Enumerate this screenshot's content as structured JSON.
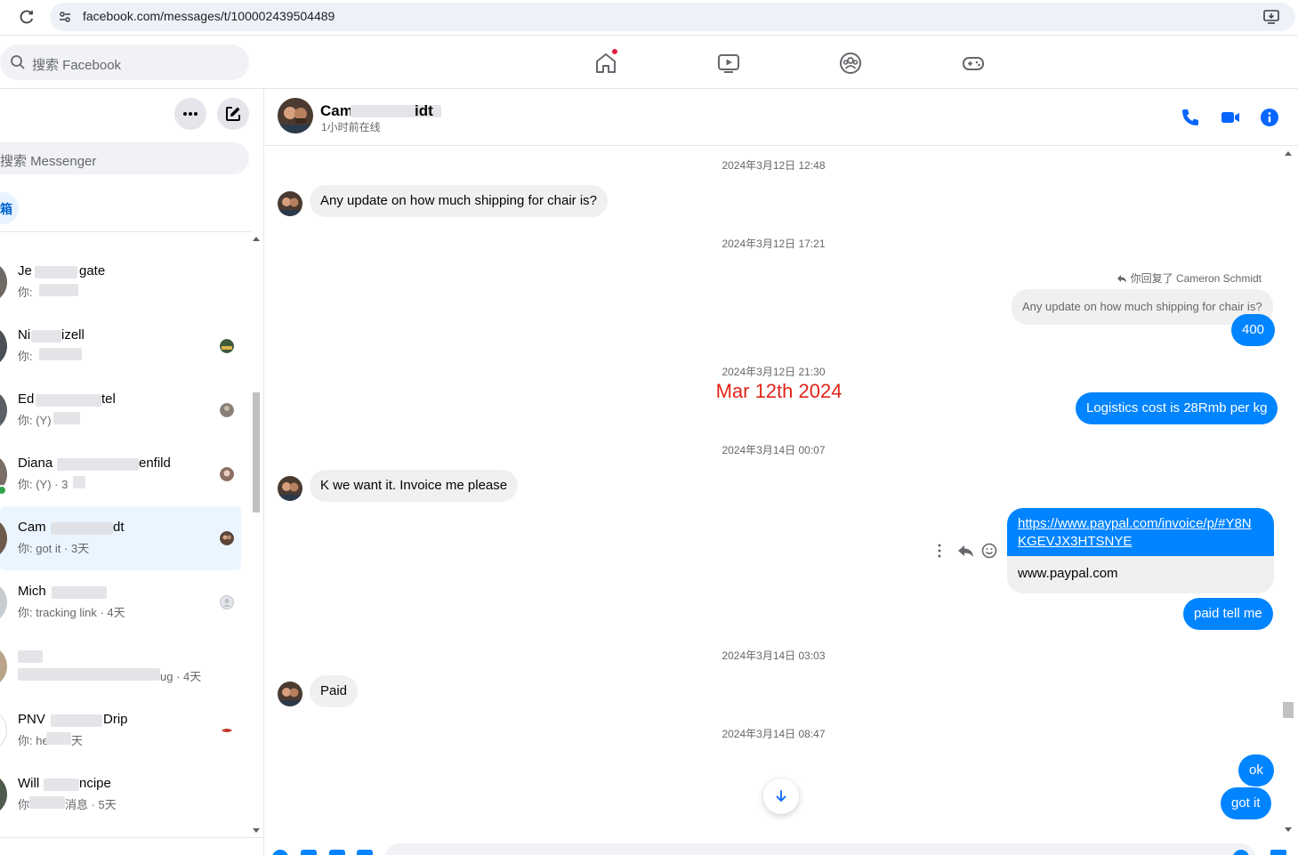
{
  "browser": {
    "url": "facebook.com/messages/t/100002439504489"
  },
  "fb_nav": {
    "search_placeholder": "搜索 Facebook"
  },
  "sidebar": {
    "search_placeholder": "搜索 Messenger",
    "inbox_label": "箱",
    "chats": [
      {
        "name": "Je",
        "name_end": "gate",
        "preview": "你:",
        "preview_end": ""
      },
      {
        "name": "Ni",
        "name_end": "izell",
        "preview": "你:",
        "preview_end": ""
      },
      {
        "name": "Ed",
        "name_end": "tel",
        "preview": "你: (Y)",
        "preview_end": ""
      },
      {
        "name": "Diana",
        "name_end": "enfild",
        "preview": "你: (Y) · 3",
        "preview_end": ""
      },
      {
        "name": "Cam",
        "name_end": "dt",
        "preview": "你: got it · 3天",
        "preview_end": ""
      },
      {
        "name": "Mich",
        "name_end": "",
        "preview": "你: tracking link · 4天",
        "preview_end": ""
      },
      {
        "name": "",
        "name_end": "",
        "preview": "",
        "preview_end": "ug · 4天"
      },
      {
        "name": "PNV",
        "name_end": "Drip",
        "preview": "你: he",
        "preview_end": "天"
      },
      {
        "name": "Will",
        "name_end": "ncipe",
        "preview": "你",
        "preview_end": "消息 · 5天"
      }
    ]
  },
  "chat": {
    "contact_name_start": "Cam",
    "contact_name_end": "idt",
    "status": "1小时前在线",
    "timestamps": [
      "2024年3月12日 12:48",
      "2024年3月12日 17:21",
      "2024年3月12日 21:30",
      "2024年3月14日 00:07",
      "2024年3月14日 03:03",
      "2024年3月14日 08:47"
    ],
    "annotation": "Mar 12th 2024",
    "reply_label": "你回复了 Cameron Schmidt",
    "quoted_text": "Any update on how much shipping for chair is?",
    "messages": {
      "m1": "Any update on how much shipping for chair is?",
      "m2": "400",
      "m3": "Logistics cost is 28Rmb per kg",
      "m4": "K we want it. Invoice me please",
      "link_url_line1": "https://www.paypal.com/invoice/p/#Y8N",
      "link_url_line2": "KGEVJX3HTSNYE",
      "link_domain": "www.paypal.com",
      "m5": "paid tell me",
      "m6": "Paid",
      "m7": "ok",
      "m8": "got it"
    }
  },
  "colors": {
    "messenger_blue": "#0084ff",
    "fb_blue": "#0866ff",
    "incoming_bubble": "#f0f0f0",
    "annotation_red": "#e1251b",
    "active_row": "#ebf5ff"
  }
}
